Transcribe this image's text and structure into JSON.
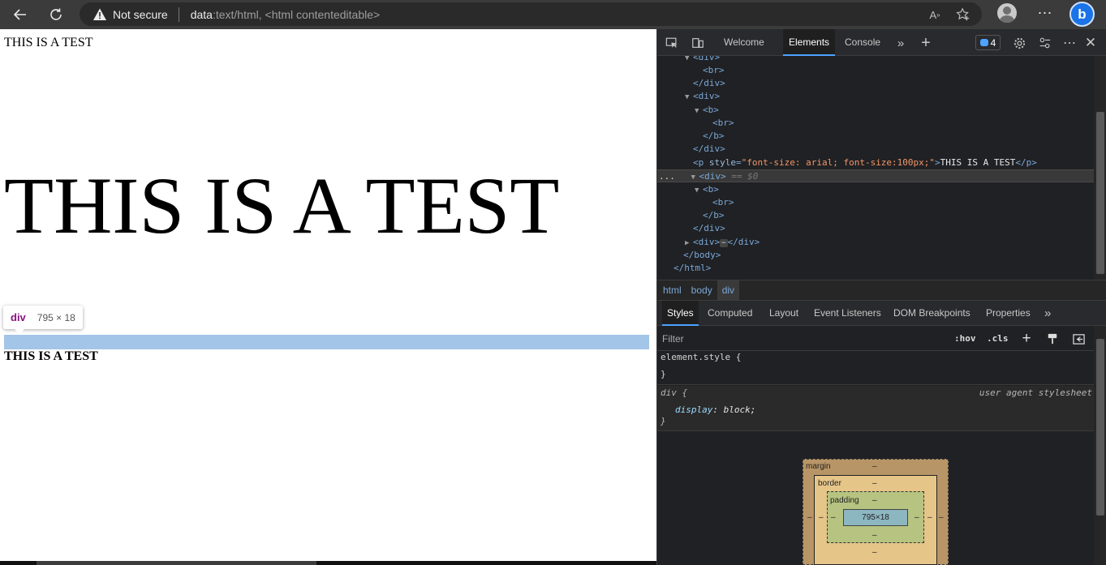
{
  "browser": {
    "security_label": "Not secure",
    "url_scheme": "data",
    "url_rest": ":text/html, <html contenteditable>",
    "read_aloud_label": "Aᴬ"
  },
  "page": {
    "line1": "THIS IS A TEST",
    "big_text": "THIS IS A TEST",
    "bold_text": "THIS IS A TEST",
    "tooltip_tag": "div",
    "tooltip_size": "795 × 18",
    "highlight_color": "#a3c5e8"
  },
  "devtools": {
    "tabs": {
      "welcome": "Welcome",
      "elements": "Elements",
      "console": "Console"
    },
    "issues_count": "4",
    "dom": {
      "l0": "<div>",
      "l1": "<br>",
      "l2": "</div>",
      "l3": "<div>",
      "l4": "<b>",
      "l5": "<br>",
      "l6": "</b>",
      "l7": "</div>",
      "p_open": "<p",
      "p_attr": "style",
      "p_val": "\"font-size: arial; font-size:100px;\"",
      "p_text": "THIS IS A TEST",
      "p_close": "</p>",
      "sel_gutter": "...",
      "sel_div": "<div>",
      "sel_eq": "== $0",
      "l10": "<b>",
      "l11": "<br>",
      "l12": "</b>",
      "l13": "</div>",
      "l14_open": "<div>",
      "l14_dots": "⋯",
      "l14_close": "</div>",
      "l15": "</body>",
      "l16": "</html>"
    },
    "breadcrumbs": [
      "html",
      "body",
      "div"
    ],
    "styles_tabs": {
      "styles": "Styles",
      "computed": "Computed",
      "layout": "Layout",
      "event_listeners": "Event Listeners",
      "dom_breakpoints": "DOM Breakpoints",
      "properties": "Properties"
    },
    "filter_placeholder": "Filter",
    "hov_label": ":hov",
    "cls_label": ".cls",
    "element_style_open": "element.style {",
    "element_style_close": "}",
    "ua_selector": "div {",
    "ua_source": "user agent stylesheet",
    "ua_prop": "display",
    "ua_val": "block;",
    "ua_close": "}",
    "box_model": {
      "margin_label": "margin",
      "border_label": "border",
      "padding_label": "padding",
      "content_size": "795×18",
      "dash": "–"
    }
  }
}
